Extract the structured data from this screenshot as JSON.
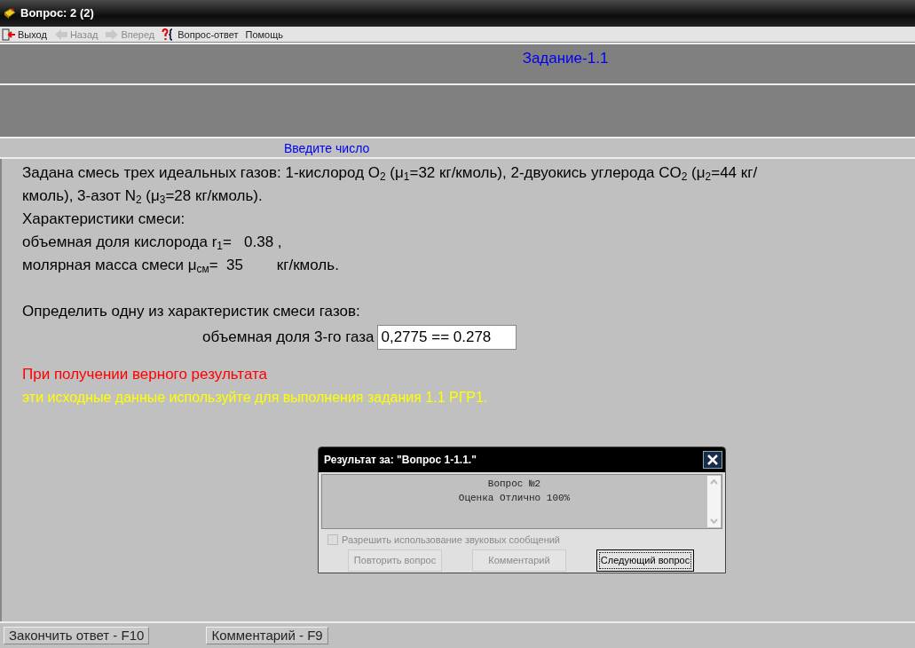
{
  "window": {
    "title": "Вопрос: 2 (2)"
  },
  "toolbar": [
    {
      "label": "Выход",
      "kind": "exit",
      "disabled": false
    },
    {
      "label": "Назад",
      "kind": "back",
      "disabled": true
    },
    {
      "label": "Вперед",
      "kind": "forward",
      "disabled": true
    },
    {
      "label": "Вопрос-ответ",
      "kind": "qa",
      "disabled": false
    },
    {
      "label": "Помощь",
      "kind": "plain",
      "disabled": false
    }
  ],
  "task_title": "Задание-1.1",
  "input_hint": "Введите число",
  "problem": {
    "statement": "Задана смесь трех идеальных газов: 1-кислород O$_{2}$ (μ$_{1}$=32 кг/кмоль), 2-двуокись углерода CO$_{2}$ (μ$_{2}$=44 кг/кмоль), 3-азот N$_{2}$ (μ$_{3}$=28 кг/кмоль).",
    "heading": "Характеристики смеси:",
    "given": [
      "объемная доля кислорода r$_{1}$=   0.38 ,",
      "молярная масса смеси μ$_{см}$=  35        кг/кмоль."
    ],
    "question": "Определить одну из характеристик смеси газов:",
    "answer_label": "объемная доля 3-го газа",
    "answer_value": "0,2775 == 0.278",
    "notes": [
      {
        "text": "При получении верного результата",
        "color": "#ff0000"
      },
      {
        "text": "эти исходные данные используйте для выполнения задания 1.1 РГР1.",
        "color": "#ffff00"
      }
    ]
  },
  "dialog": {
    "title": "Результат за: \"Вопрос 1-1.1.\"",
    "lines": [
      "Вопрос №2",
      "Оценка Отлично 100%"
    ],
    "checkbox": {
      "label": "Разрешить использование звуковых сообщений",
      "checked": false,
      "disabled": true
    },
    "buttons": [
      {
        "label": "Повторить вопрос",
        "disabled": true,
        "focused": false
      },
      {
        "label": "Комментарий",
        "disabled": true,
        "focused": false
      },
      {
        "label": "Следующий вопрос",
        "disabled": false,
        "focused": true
      }
    ]
  },
  "status_bar": [
    "Закончить ответ - F10",
    "Комментарий - F9"
  ]
}
